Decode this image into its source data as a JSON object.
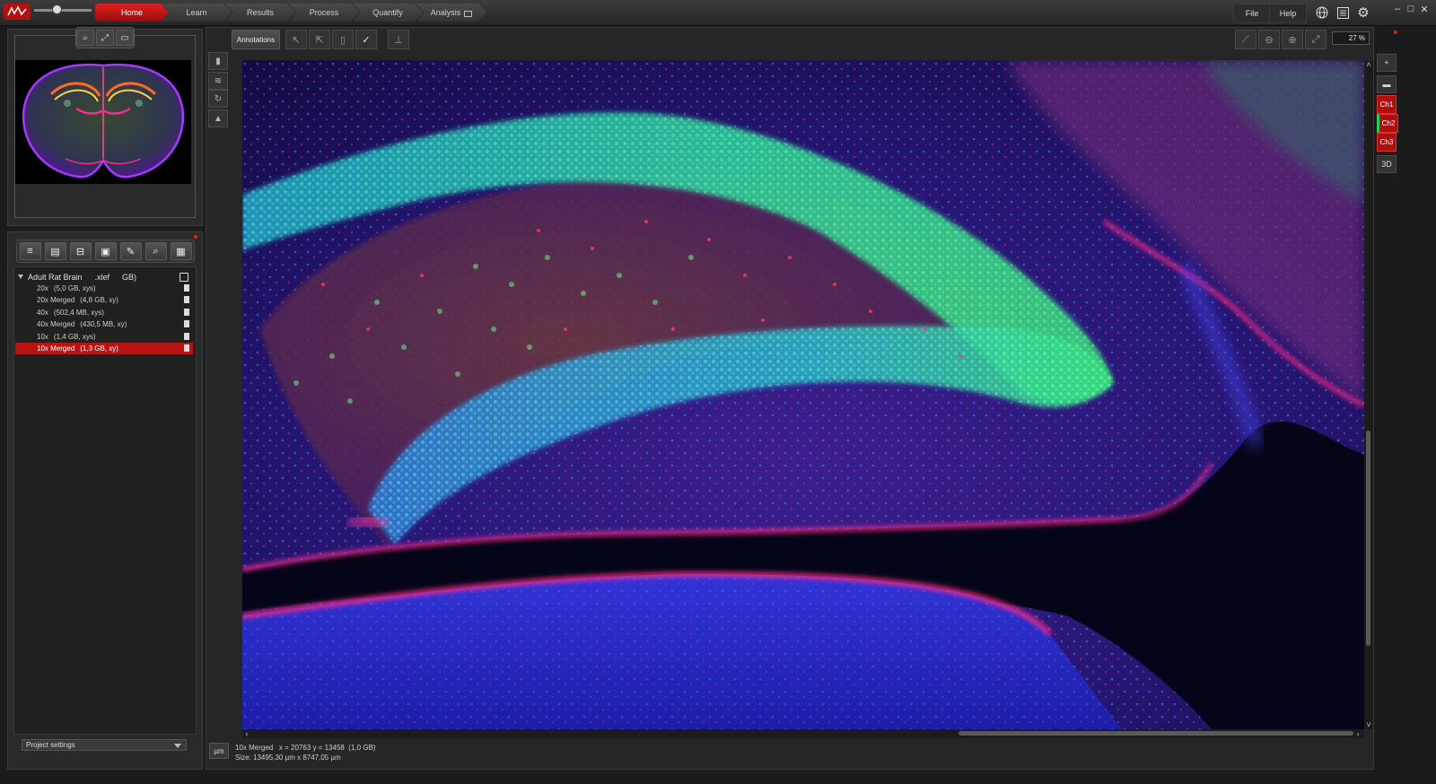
{
  "workflow_tabs": [
    "Home",
    "Learn",
    "Results",
    "Process",
    "Quantify",
    "Analysis"
  ],
  "menu": {
    "file": "File",
    "help": "Help"
  },
  "top_icons": [
    "globe-icon",
    "list-icon",
    "gear-icon"
  ],
  "window_controls": {
    "minimize": "–",
    "maximize": "□",
    "close": "✕"
  },
  "project_tree": {
    "root": {
      "name": "Adult Rat Brain",
      "ext": ".xlef",
      "size_suffix": "GB)"
    },
    "items": [
      {
        "label": "20x",
        "info": "(5,0 GB, xys)"
      },
      {
        "label": "20x Merged",
        "info": "(4,8 GB, xy)"
      },
      {
        "label": "40x",
        "info": "(502,4 MB, xys)"
      },
      {
        "label": "40x Merged",
        "info": "(430,5 MB, xy)"
      },
      {
        "label": "10x",
        "info": "(1,4 GB, xys)"
      },
      {
        "label": "10x Merged",
        "info": "(1,3 GB, xy)"
      }
    ],
    "selected_index": 5
  },
  "project_settings": "Project settings",
  "viewer": {
    "annotations_label": "Annotations",
    "zoom_level": "27 %",
    "channels": [
      "Ch1",
      "Ch2",
      "Ch3"
    ],
    "three_d_label": "3D",
    "plus_label": "+",
    "unit_button": "µm"
  },
  "status": {
    "line1": "10x Merged   x = 20763 y = 13458  (1,0 GB)",
    "line2": "Size: 13495,30 µm x 8747,05 µm"
  },
  "colors": {
    "accent_red": "#c41414",
    "nucleus_blue": "#2a2cff",
    "neuron_green": "#35e07a",
    "glia_red": "#ff2a5a"
  }
}
